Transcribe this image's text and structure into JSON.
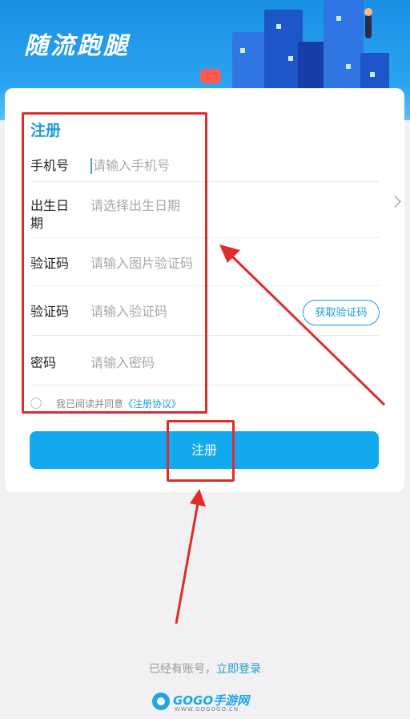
{
  "banner": {
    "brand": "随流跑腿"
  },
  "form": {
    "title": "注册",
    "rows": [
      {
        "label": "手机号",
        "placeholder": "请输入手机号"
      },
      {
        "label": "出生日期",
        "placeholder": "请选择出生日期"
      },
      {
        "label": "验证码",
        "placeholder": "请输入图片验证码"
      },
      {
        "label": "验证码",
        "placeholder": "请输入验证码"
      },
      {
        "label": "密码",
        "placeholder": "请输入密码"
      }
    ],
    "get_code": "获取验证码",
    "agree_prefix": "我已阅读并同意",
    "agree_link": "《注册协议》",
    "submit": "注册"
  },
  "footer": {
    "has_account": "已经有账号，",
    "login_link": "立即登录",
    "logo_text": "GOGO手游网",
    "logo_sub": "WWW.GOGOGO.CN"
  },
  "colors": {
    "accent": "#1e9cd6",
    "button": "#12a9ee",
    "annotation": "#e12b2b"
  }
}
